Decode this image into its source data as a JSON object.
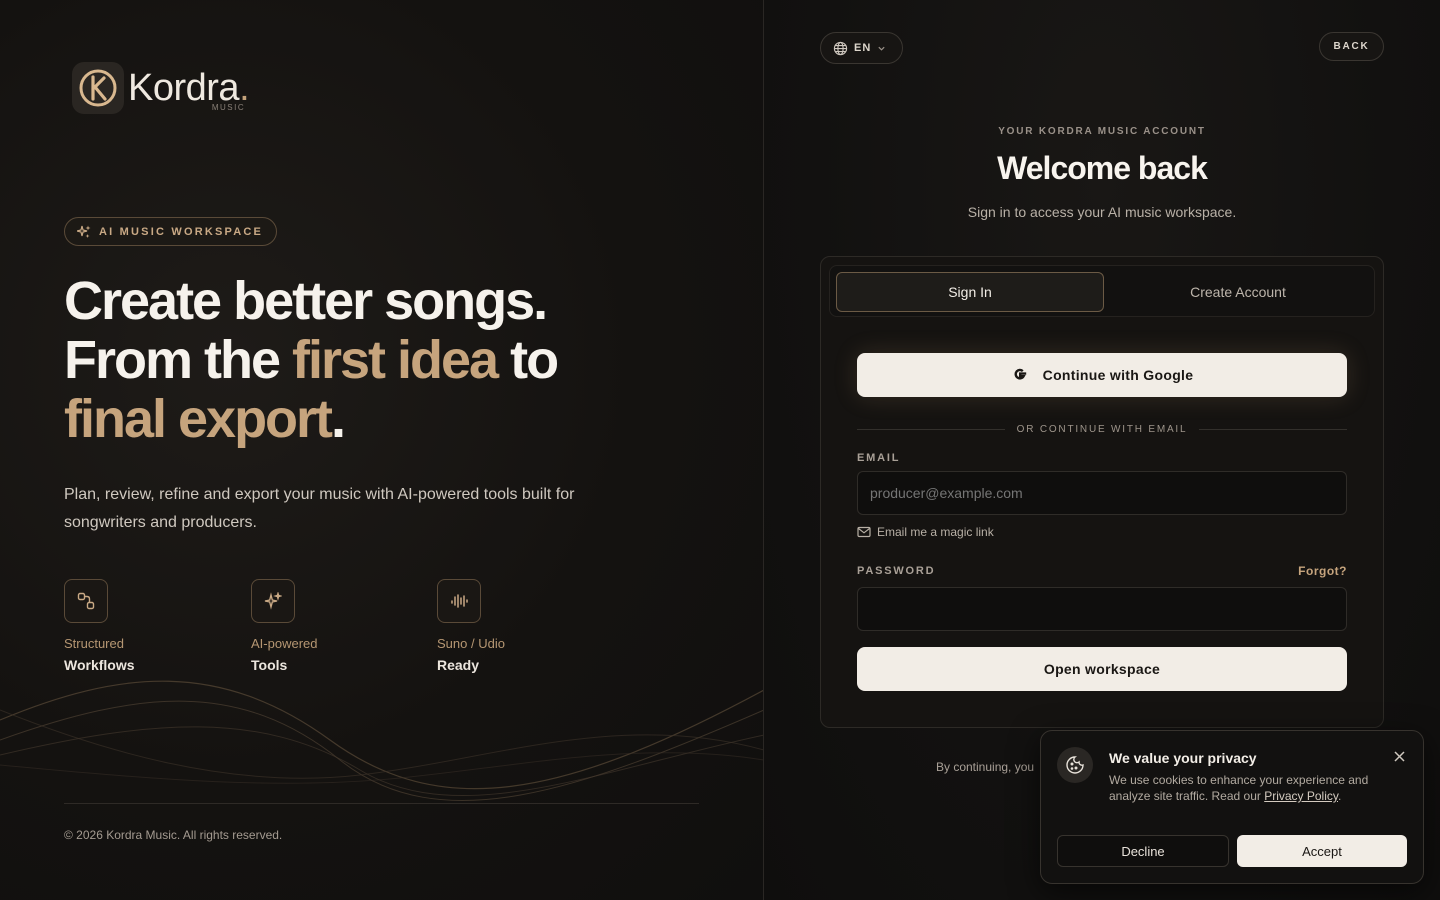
{
  "brand": {
    "name": "Kordra",
    "dot": ".",
    "sub": "MUSIC",
    "accent": "#c6a47d"
  },
  "hero": {
    "badge": "AI MUSIC WORKSPACE",
    "line1": "Create better songs.",
    "line2a": "From the ",
    "line2b": "first idea",
    "line2c": " to",
    "line3a": "final export",
    "line3b": ".",
    "lead": "Plan, review, refine and export your music with AI-powered tools built for songwriters and producers."
  },
  "features": [
    {
      "top": "Structured",
      "bottom": "Workflows",
      "icon": "workflow-icon"
    },
    {
      "top": "AI-powered",
      "bottom": "Tools",
      "icon": "sparkles-icon"
    },
    {
      "top": "Suno / Udio",
      "bottom": "Ready",
      "icon": "waveform-icon"
    }
  ],
  "footer": {
    "copyright": "© 2026 Kordra Music. All rights reserved."
  },
  "topbar": {
    "language": "EN",
    "back": "BACK"
  },
  "auth": {
    "eyebrow": "YOUR KORDRA MUSIC ACCOUNT",
    "title": "Welcome back",
    "subtitle": "Sign in to access your AI music workspace.",
    "tabs": {
      "signin": "Sign In",
      "create": "Create Account"
    },
    "google": "Continue with Google",
    "divider": "OR CONTINUE WITH EMAIL",
    "email_label": "EMAIL",
    "email_placeholder": "producer@example.com",
    "magic_link": "Email me a magic link",
    "password_label": "PASSWORD",
    "forgot": "Forgot?",
    "submit": "Open workspace",
    "terms": "By continuing, you"
  },
  "cookie": {
    "title": "We value your privacy",
    "text": "We use cookies to enhance your experience and analyze site traffic. Read our ",
    "link": "Privacy Policy",
    "period": ".",
    "decline": "Decline",
    "accept": "Accept"
  }
}
